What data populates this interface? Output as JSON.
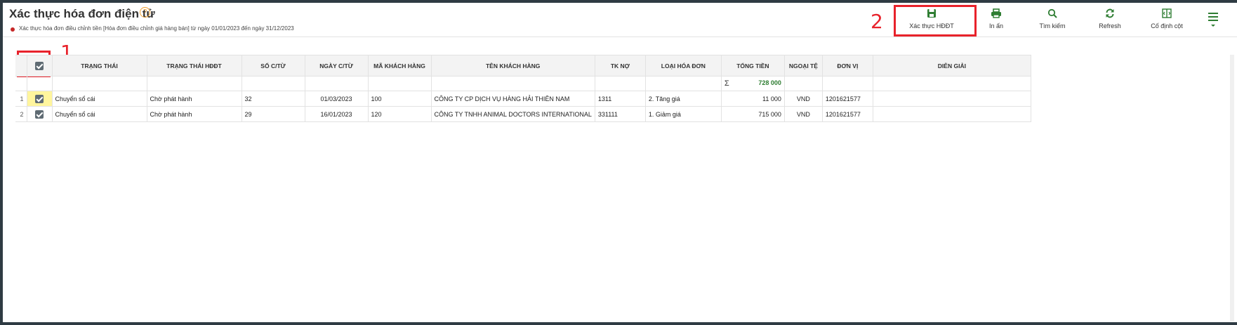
{
  "page": {
    "title": "Xác thực hóa đơn điện tử",
    "subtitle": "Xác thực hóa đơn điều chỉnh tiền [Hóa đơn điều chỉnh giá hàng bán] từ ngày 01/01/2023 đến ngày 31/12/2023"
  },
  "toolbar": {
    "verify_label": "Xác thực HĐĐT",
    "print_label": "In ấn",
    "search_label": "Tìm kiếm",
    "refresh_label": "Refresh",
    "pin_label": "Cố định cột"
  },
  "annotations": {
    "one": "1",
    "two": "2"
  },
  "table": {
    "headers": [
      "TRẠNG THÁI",
      "TRẠNG THÁI HĐĐT",
      "SỐ C/TỪ",
      "NGÀY C/TỪ",
      "MÃ KHÁCH HÀNG",
      "TÊN KHÁCH HÀNG",
      "TK NỢ",
      "LOẠI HÓA ĐƠN",
      "TỔNG TIỀN",
      "NGOẠI TỆ",
      "ĐƠN VỊ",
      "DIỄN GIẢI"
    ],
    "total": "728 000",
    "rows": [
      {
        "no": "1",
        "status": "Chuyển sổ cái",
        "einvoice_status": "Chờ phát hành",
        "doc_no": "32",
        "doc_date": "01/03/2023",
        "customer_code": "100",
        "customer_name": "CÔNG TY CP DỊCH VỤ HÀNG HẢI THIÊN NAM",
        "debit_account": "1311",
        "invoice_type": "2. Tăng giá",
        "total": "11 000",
        "currency": "VND",
        "unit": "1201621577",
        "description": ""
      },
      {
        "no": "2",
        "status": "Chuyển sổ cái",
        "einvoice_status": "Chờ phát hành",
        "doc_no": "29",
        "doc_date": "16/01/2023",
        "customer_code": "120",
        "customer_name": "CÔNG TY TNHH ANIMAL DOCTORS INTERNATIONAL",
        "debit_account": "331111",
        "invoice_type": "1. Giảm giá",
        "total": "715 000",
        "currency": "VND",
        "unit": "1201621577",
        "description": ""
      }
    ]
  },
  "colors": {
    "accent": "#2e7d32",
    "annotation": "#e8222b",
    "highlight": "#fff59d"
  }
}
